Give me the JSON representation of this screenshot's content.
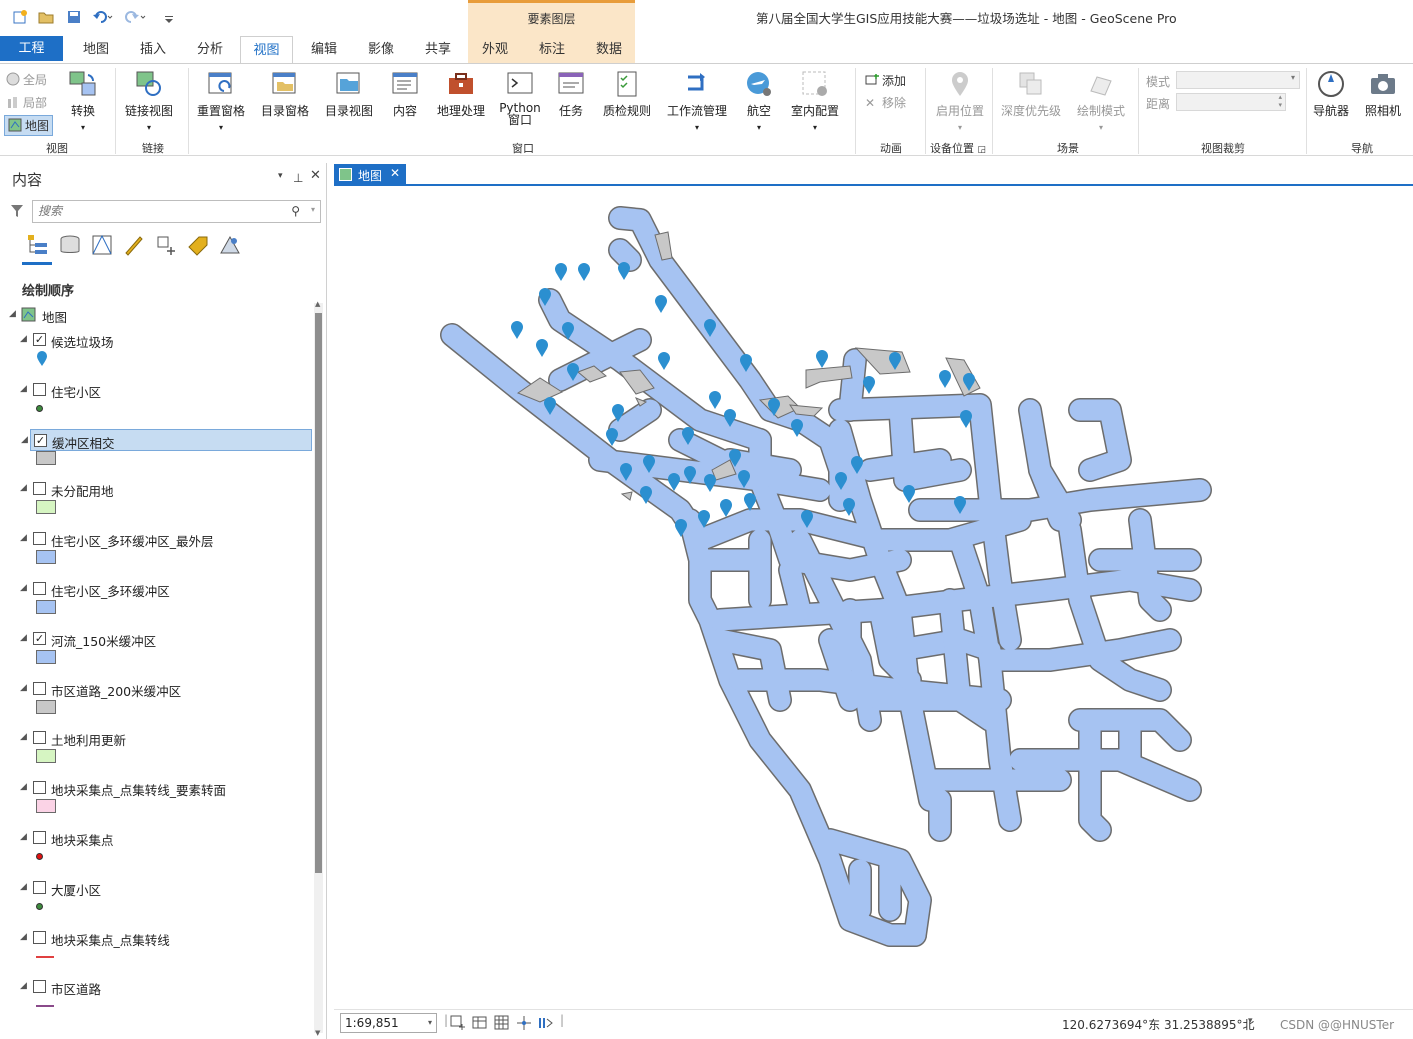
{
  "window": {
    "title": "第八届全国大学生GIS应用技能大赛——垃圾场选址 - 地图 - GeoScene Pro",
    "context_tab_group": "要素图层"
  },
  "tabs": [
    {
      "label": "工程"
    },
    {
      "label": "地图"
    },
    {
      "label": "插入"
    },
    {
      "label": "分析"
    },
    {
      "label": "视图"
    },
    {
      "label": "编辑"
    },
    {
      "label": "影像"
    },
    {
      "label": "共享"
    },
    {
      "label": "外观"
    },
    {
      "label": "标注"
    },
    {
      "label": "数据"
    }
  ],
  "ribbon": {
    "view_group": {
      "items": [
        "全局",
        "局部",
        "地图"
      ],
      "convert": "转换",
      "label": "视图"
    },
    "link_group": {
      "link_view": "链接视图",
      "label": "链接"
    },
    "window_group": {
      "buttons": [
        "重置窗格",
        "目录窗格",
        "目录视图",
        "内容",
        "地理处理",
        "Python\n窗口",
        "任务",
        "质检规则",
        "工作流管理",
        "航空",
        "室内配置"
      ],
      "label": "窗口"
    },
    "animation_group": {
      "add": "添加",
      "remove": "移除",
      "label": "动画"
    },
    "device_group": {
      "enable_location": "启用位置",
      "label": "设备位置"
    },
    "scene_group": {
      "depth_priority": "深度优先级",
      "draw_mode": "绘制模式",
      "label": "场景"
    },
    "clip_group": {
      "mode_label": "模式",
      "distance_label": "距离",
      "label": "视图裁剪"
    },
    "nav_group": {
      "navigator": "导航器",
      "camera": "照相机",
      "label": "导航"
    }
  },
  "contents": {
    "title": "内容",
    "search_placeholder": "搜索",
    "draw_order": "绘制顺序",
    "map_name": "地图",
    "layers": [
      {
        "name": "候选垃圾场",
        "checked": true,
        "symbol": "marker",
        "color": "#2b8fd0"
      },
      {
        "name": "住宅小区",
        "checked": false,
        "symbol": "dot",
        "color": "#3d8b3d"
      },
      {
        "name": "缓冲区相交",
        "checked": true,
        "symbol": "box",
        "color": "#c8c8c8",
        "selected": true
      },
      {
        "name": "未分配用地",
        "checked": false,
        "symbol": "box",
        "color": "#d6f5c2"
      },
      {
        "name": "住宅小区_多环缓冲区_最外层",
        "checked": false,
        "symbol": "box",
        "color": "#a6c3f2"
      },
      {
        "name": "住宅小区_多环缓冲区",
        "checked": false,
        "symbol": "box",
        "color": "#a6c3f2"
      },
      {
        "name": "河流_150米缓冲区",
        "checked": true,
        "symbol": "box",
        "color": "#a6c3f2"
      },
      {
        "name": "市区道路_200米缓冲区",
        "checked": false,
        "symbol": "box",
        "color": "#c8c8c8"
      },
      {
        "name": "土地利用更新",
        "checked": false,
        "symbol": "box",
        "color": "#d6f5c2"
      },
      {
        "name": "地块采集点_点集转线_要素转面",
        "checked": false,
        "symbol": "box",
        "color": "#fbd3e6"
      },
      {
        "name": "地块采集点",
        "checked": false,
        "symbol": "dot",
        "color": "#e01010"
      },
      {
        "name": "大厦小区",
        "checked": false,
        "symbol": "dot",
        "color": "#3d8b3d"
      },
      {
        "name": "地块采集点_点集转线",
        "checked": false,
        "symbol": "line",
        "color": "#e04040"
      },
      {
        "name": "市区道路",
        "checked": false,
        "symbol": "line",
        "color": "#8a4a8a"
      }
    ]
  },
  "map": {
    "tab_label": "地图",
    "scale": "1:69,851",
    "coordinates": "120.6273694°东 31.2538895°北",
    "watermark": "CSDN @@HNUSTer",
    "fill_color": "#a6c3f2",
    "marker_color": "#2b8fd0",
    "gray_color": "#c8c8c8"
  }
}
